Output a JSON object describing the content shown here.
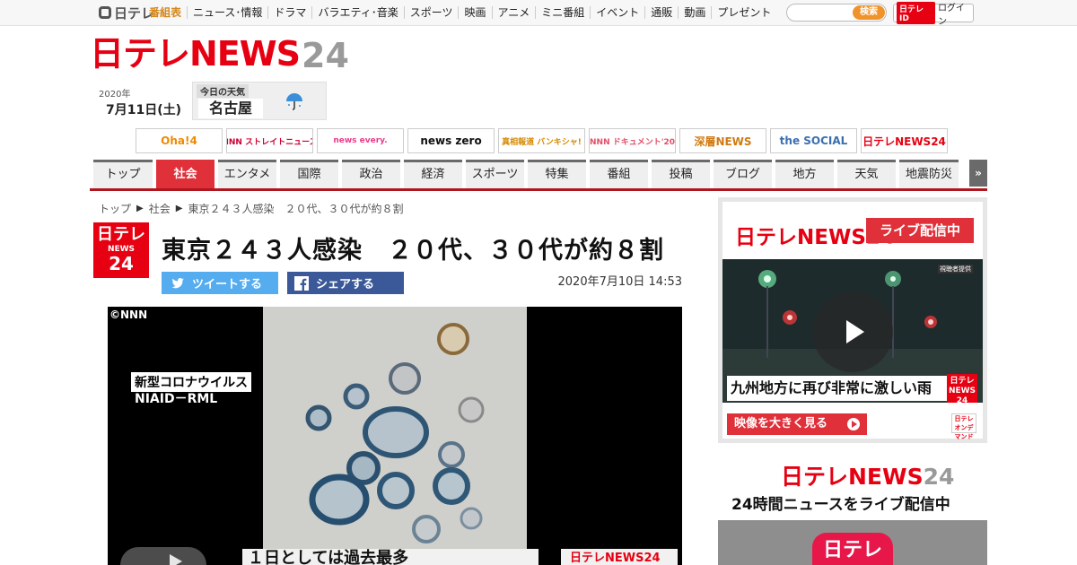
{
  "topnav": {
    "logo": "日テレ",
    "links": [
      "番組表",
      "ニュース･情報",
      "ドラマ",
      "バラエティ･音楽",
      "スポーツ",
      "映画",
      "アニメ",
      "ミニ番組",
      "イベント",
      "通販",
      "動画",
      "プレゼント"
    ],
    "search_button": "検索",
    "login_id": "日テレID",
    "login_label": "ログイン"
  },
  "site": {
    "logo_red": "日テレNEWS",
    "logo_grey": "24",
    "year": "2020年",
    "date": "7月11日(土)",
    "weather_label": "今日の天気",
    "weather_city": "名古屋",
    "weather_icon": "umbrella-icon"
  },
  "programs": [
    "Oha!4",
    "NNN ストレイトニュース",
    "news every.",
    "news zero",
    "真相報道 バンキシャ!",
    "NNN ドキュメント'20",
    "深層NEWS",
    "the SOCIAL",
    "日テレNEWS24"
  ],
  "categories": [
    {
      "label": "トップ",
      "active": false,
      "w": 66
    },
    {
      "label": "社会",
      "active": true,
      "w": 65
    },
    {
      "label": "エンタメ",
      "active": false,
      "w": 65
    },
    {
      "label": "国際",
      "active": false,
      "w": 65
    },
    {
      "label": "政治",
      "active": false,
      "w": 65
    },
    {
      "label": "経済",
      "active": false,
      "w": 65
    },
    {
      "label": "スポーツ",
      "active": false,
      "w": 65
    },
    {
      "label": "特集",
      "active": false,
      "w": 65
    },
    {
      "label": "番組",
      "active": false,
      "w": 65
    },
    {
      "label": "投稿",
      "active": false,
      "w": 65
    },
    {
      "label": "ブログ",
      "active": false,
      "w": 65
    },
    {
      "label": "地方",
      "active": false,
      "w": 65
    },
    {
      "label": "天気",
      "active": false,
      "w": 65
    },
    {
      "label": "地震防災",
      "active": false,
      "w": 66
    }
  ],
  "breadcrumb": [
    "トップ",
    "社会",
    "東京２４３人感染　２０代、３０代が約８割"
  ],
  "article": {
    "badge_top": "日テレ",
    "badge_mid": "NEWS",
    "badge_bottom": "24",
    "headline": "東京２４３人感染　２０代、３０代が約８割",
    "tweet_label": "ツイートする",
    "share_label": "シェアする",
    "published": "2020年7月10日 14:53"
  },
  "video": {
    "copyright": "©NNN",
    "caption_line1": "新型コロナウイルス",
    "caption_line2": "NIAID－RML",
    "subtitle": "１日としては過去最多",
    "logo": "日テレNEWS24"
  },
  "live": {
    "logo_red": "日テレNEWS",
    "logo_grey": "24",
    "badge": "ライブ配信中",
    "video_tag": "視聴者提供",
    "caption": "九州地方に再び非常に激しい雨",
    "corner": "日テレ NEWS 24",
    "big_button": "映像を大きく見る",
    "ntv_mark": "日テレ オンデマンド"
  },
  "side2": {
    "logo_red": "日テレNEWS",
    "logo_grey": "24",
    "subtitle": "24時間ニュースをライブ配信中",
    "app_label": "日テレ"
  },
  "colors": {
    "brand_red": "#e60012",
    "active_tab": "#e0303a",
    "twitter": "#55acee",
    "facebook": "#3b5998"
  }
}
